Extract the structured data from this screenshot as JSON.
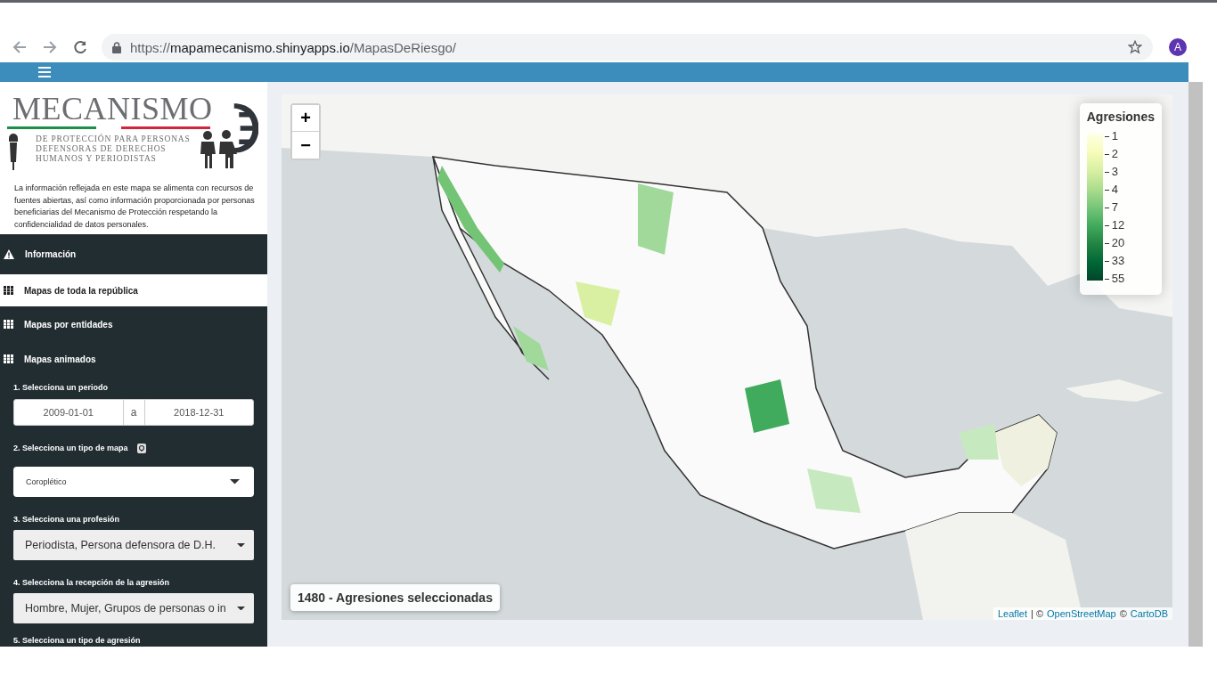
{
  "browser": {
    "url": {
      "scheme": "https://",
      "host": "mapamecanismo.shinyapps.io",
      "path": "/MapasDeRiesgo/"
    },
    "avatar": "A"
  },
  "sidebar": {
    "logo": {
      "title": "MECANISMO",
      "subtitle": [
        "DE PROTECCIÓN PARA PERSONAS",
        "DEFENSORAS DE DERECHOS",
        "HUMANOS Y PERIODISTAS"
      ]
    },
    "disclaimer": "La información reflejada en este mapa se alimenta con recursos de fuentes abiertas, así como información proporcionada por personas beneficiarias del Mecanismo de Protección respetando la confidencialidad de datos personales.",
    "menu": [
      {
        "label": "Información",
        "kind": "alert",
        "selected": false
      },
      {
        "label": "Mapas de toda la república",
        "kind": "map",
        "selected": true
      },
      {
        "label": "Mapas por entidades",
        "kind": "map",
        "selected": false
      },
      {
        "label": "Mapas animados",
        "kind": "map",
        "selected": false
      }
    ],
    "form": [
      {
        "kind": "daterange",
        "label": "1. Selecciona un periodo",
        "start": "2009-01-01",
        "separator": "a",
        "end": "2018-12-31"
      },
      {
        "kind": "select",
        "label": "2. Selecciona un tipo de mapa",
        "help": true,
        "value": "Coroplético"
      },
      {
        "kind": "picker",
        "label": "3. Selecciona una profesión",
        "value": "Periodista, Persona defensora de D.H."
      },
      {
        "kind": "picker",
        "label": "4. Selecciona la recepción de la agresión",
        "value": "Hombre, Mujer, Grupos de personas o in"
      },
      {
        "kind": "heading",
        "label": "5. Selecciona un tipo de agresión"
      }
    ]
  },
  "map": {
    "kind": "picture",
    "zoom_in": "+",
    "zoom_out": "−",
    "legend": {
      "title": "Agresiones",
      "ticks": [
        "1",
        "2",
        "3",
        "4",
        "7",
        "12",
        "20",
        "33",
        "55"
      ]
    },
    "summary": "1480 - Agresiones seleccionadas",
    "attribution": [
      {
        "kind": "link",
        "text": "Leaflet"
      },
      {
        "kind": "text",
        "text": "| ©"
      },
      {
        "kind": "link",
        "text": "OpenStreetMap"
      },
      {
        "kind": "text",
        "text": "©"
      },
      {
        "kind": "link",
        "text": "CartoDB"
      }
    ]
  }
}
